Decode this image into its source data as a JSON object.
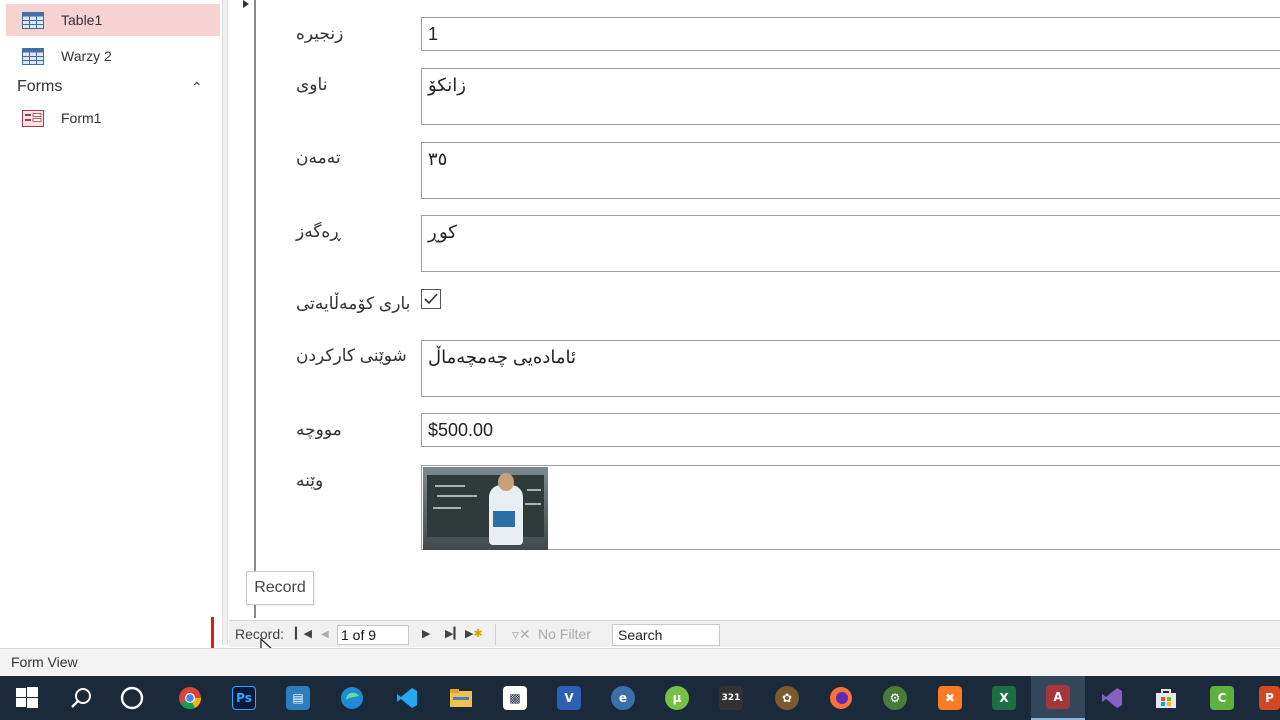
{
  "nav": {
    "items": [
      {
        "label": "Table1",
        "icon": "table-icon",
        "selected": true
      },
      {
        "label": "Warzy 2",
        "icon": "table-icon",
        "selected": false
      }
    ],
    "group_title": "Forms",
    "group_items": [
      {
        "label": "Form1",
        "icon": "form-icon"
      }
    ]
  },
  "form": {
    "fields": [
      {
        "label": "زنجیرە",
        "value": "1"
      },
      {
        "label": "ناوی",
        "value": "زانکۆ"
      },
      {
        "label": "تەمەن",
        "value": "٣٥"
      },
      {
        "label": "ڕەگەز",
        "value": "کوڕ"
      },
      {
        "label": "باری کۆمەڵایەتی",
        "checked": true
      },
      {
        "label": "شوێنی کارکردن",
        "value": "ئامادەیی چەمچەماڵ"
      },
      {
        "label": "مووچە",
        "value": "$500.00"
      },
      {
        "label": "وێنە"
      }
    ]
  },
  "tooltip": "Record",
  "record_nav": {
    "label": "Record:",
    "current": "1 of 9",
    "filter": "No Filter",
    "search": "Search"
  },
  "status": "Form View",
  "colors": {
    "nav_selected": "#f6d2d0",
    "taskbar": "#1b2a3a",
    "highlight_mark": "#e01a1a"
  },
  "taskbar": {
    "apps": [
      "windows-start-icon",
      "search-icon",
      "cortana-icon",
      "chrome-icon",
      "photoshop-icon",
      "explorer-users-icon",
      "edge-icon",
      "vscode-icon",
      "file-explorer-icon",
      "app-icon",
      "visio-icon",
      "app-icon",
      "utorrent-icon",
      "media-icon",
      "app-icon",
      "firefox-icon",
      "app-icon",
      "xampp-icon",
      "excel-icon",
      "access-icon",
      "visual-studio-icon",
      "store-icon",
      "camtasia-icon",
      "powerpoint-icon"
    ]
  }
}
